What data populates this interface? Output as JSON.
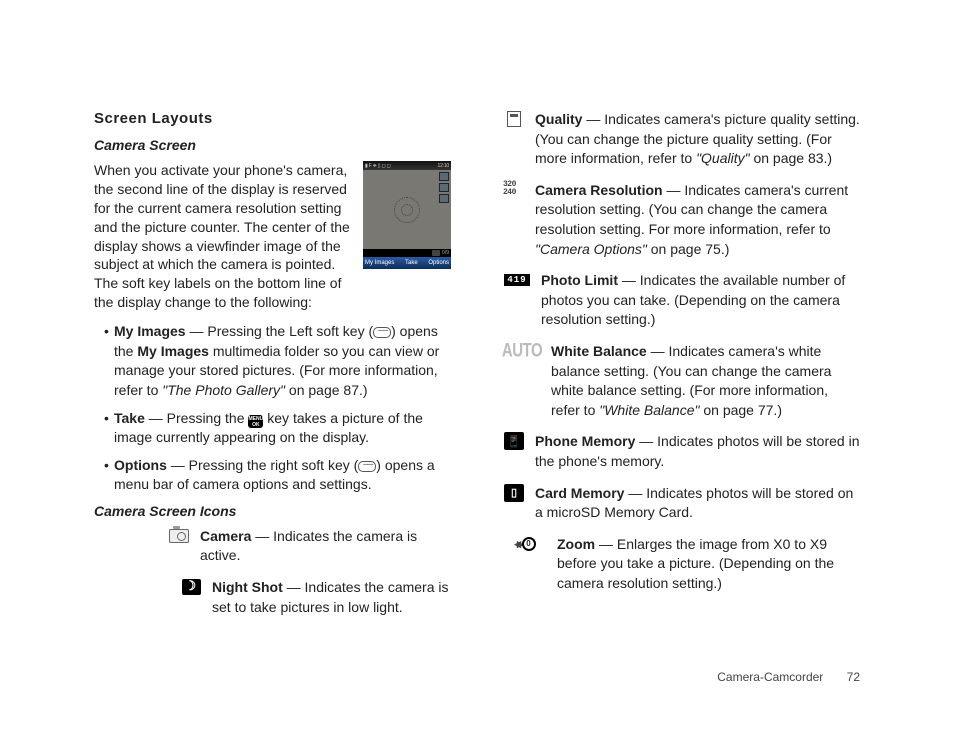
{
  "heading": "Screen Layouts",
  "sub_camera": "Camera Screen",
  "intro": "When you activate your phone's camera, the second line of the display is reserved for the current camera resolution setting and the picture counter. The center of the display shows a viewfinder image of the subject at which the camera is pointed. The soft key labels on the bottom line of the display change to the following:",
  "preview": {
    "status_left": "▮ F ⎈ ▯ ◻ ◻",
    "status_right": "12:10",
    "sk_left": "My Images",
    "sk_mid": "Take",
    "sk_right": "Options",
    "counter": "0/9"
  },
  "bullets": {
    "myimages_label": "My Images",
    "myimages_1": " — Pressing the Left soft key (",
    "myimages_2": ") opens the ",
    "myimages_3": " multimedia folder so you can view or manage your stored pictures. (For more information, refer to ",
    "myimages_ref": "\"The Photo Gallery\"",
    "myimages_4": "  on page 87.)",
    "take_label": "Take",
    "take_1": " — Pressing the ",
    "take_2": " key takes a picture of the image currently appearing on the display.",
    "options_label": "Options",
    "options_1": " — Pressing the right soft key (",
    "options_2": ") opens a menu bar of camera options and settings."
  },
  "sub_icons": "Camera Screen Icons",
  "icons": {
    "camera_l": "Camera",
    "camera_t": " — Indicates the camera is active.",
    "night_l": "Night Shot",
    "night_t": " — Indicates the camera is set to take pictures in low light.",
    "quality_l": "Quality",
    "quality_t1": " — Indicates camera's picture quality setting. (You can change the picture quality setting. (For more information, refer to ",
    "quality_ref": "\"Quality\"",
    "quality_t2": "  on page 83.)",
    "res_glyph": "320\n240",
    "res_l": "Camera Resolution",
    "res_t1": " — Indicates camera's current resolution setting. (You can change the camera resolution setting. For more information, refer to ",
    "res_ref": "\"Camera Options\"",
    "res_t2": "  on page 75.)",
    "limit_glyph": "419",
    "limit_l": "Photo Limit",
    "limit_t": " — Indicates the available number of photos you can take. (Depending on the camera resolution setting.)",
    "wb_glyph": "AUTO",
    "wb_l": "White Balance",
    "wb_t1": " — Indicates camera's white balance setting. (You can change the camera white balance setting. (For more information, refer to ",
    "wb_ref": "\"White Balance\"",
    "wb_t2": "  on page 77.)",
    "pmem_l": "Phone Memory",
    "pmem_t": " — Indicates photos will be stored in the phone's memory.",
    "cmem_l": "Card Memory",
    "cmem_t": " — Indicates photos will be stored on a microSD Memory Card.",
    "zoom_glyph": "0",
    "zoom_l": "Zoom",
    "zoom_t": " — Enlarges the image from X0 to X9 before you take a picture. (Depending on the camera resolution setting.)"
  },
  "footer_section": "Camera-Camcorder",
  "footer_page": "72",
  "menu_key": "MENU\nOK"
}
